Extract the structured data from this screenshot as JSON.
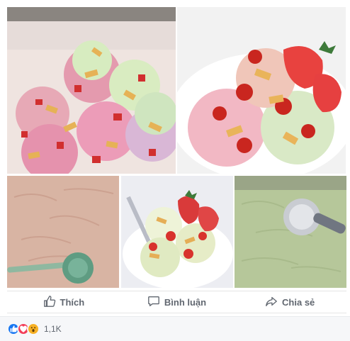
{
  "photos": [
    {
      "name": "photo-1"
    },
    {
      "name": "photo-2"
    },
    {
      "name": "photo-3"
    },
    {
      "name": "photo-4"
    },
    {
      "name": "photo-5"
    }
  ],
  "actions": {
    "like_label": "Thích",
    "comment_label": "Bình luận",
    "share_label": "Chia sẻ"
  },
  "reactions": {
    "icons": [
      "like-reaction-icon",
      "love-reaction-icon",
      "wow-reaction-icon"
    ],
    "count": "1,1K"
  },
  "colors": {
    "like": "#1877f2",
    "love": "#f33e58",
    "wow": "#f7b125"
  }
}
